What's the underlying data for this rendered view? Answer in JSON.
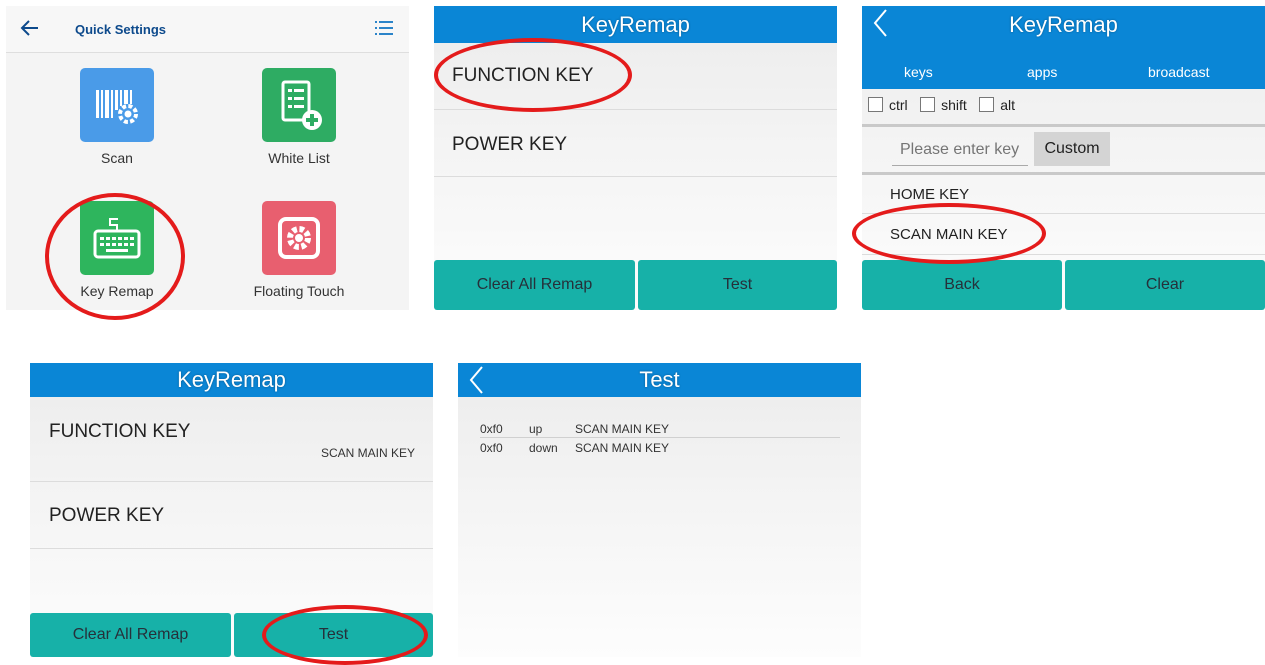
{
  "quick_settings": {
    "title": "Quick Settings",
    "items": [
      {
        "label": "Scan",
        "icon": "barcode-gear-icon",
        "color": "#4a9be8"
      },
      {
        "label": "White List",
        "icon": "checklist-add-icon",
        "color": "#2eac63"
      },
      {
        "label": "Key Remap",
        "icon": "keyboard-icon",
        "color": "#2eb55d"
      },
      {
        "label": "Floating Touch",
        "icon": "gear-box-icon",
        "color": "#e85f6f"
      }
    ]
  },
  "keyremap_main": {
    "title": "KeyRemap",
    "rows": [
      {
        "label": "FUNCTION KEY"
      },
      {
        "label": "POWER KEY"
      }
    ],
    "buttons": {
      "clear_all": "Clear All Remap",
      "test": "Test"
    }
  },
  "keyremap_select": {
    "title": "KeyRemap",
    "tabs": [
      "keys",
      "apps",
      "broadcast"
    ],
    "modifiers": [
      "ctrl",
      "shift",
      "alt"
    ],
    "input_placeholder": "Please enter key",
    "custom_label": "Custom",
    "options": [
      "HOME KEY",
      "SCAN MAIN KEY"
    ],
    "buttons": {
      "back": "Back",
      "clear": "Clear"
    }
  },
  "keyremap_result": {
    "title": "KeyRemap",
    "rows": [
      {
        "label": "FUNCTION KEY",
        "mapped": "SCAN MAIN KEY"
      },
      {
        "label": "POWER KEY"
      }
    ],
    "buttons": {
      "clear_all": "Clear All Remap",
      "test": "Test"
    }
  },
  "test_screen": {
    "title": "Test",
    "log": [
      {
        "code": "0xf0",
        "action": "up",
        "key": "SCAN MAIN KEY"
      },
      {
        "code": "0xf0",
        "action": "down",
        "key": "SCAN MAIN KEY"
      }
    ]
  },
  "colors": {
    "header_blue": "#0a86d6",
    "button_teal": "#17b1a8",
    "highlight_red": "#e41b1b"
  }
}
